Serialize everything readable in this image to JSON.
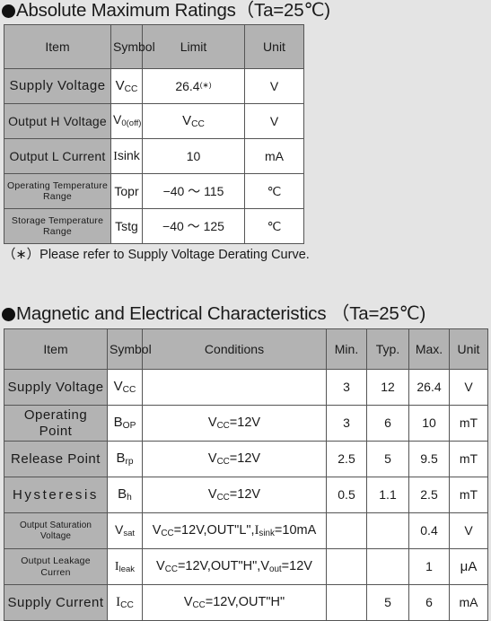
{
  "sections": [
    {
      "id": "absolute-maximum-ratings",
      "title": "Absolute Maximum Ratings（Ta=25℃)",
      "note": "（∗）Please refer to Supply Voltage Derating Curve.",
      "headers": [
        "Item",
        "Symbol",
        "Limit",
        "Unit"
      ],
      "rows": [
        {
          "item": "Supply  Voltage",
          "symbol_base": "V",
          "symbol_sub": "CC",
          "limit": "26.4",
          "limit_sup": "(∗)",
          "unit": "V"
        },
        {
          "item": "Output H Voltage",
          "symbol_base": "V",
          "symbol_sub": "0(off)",
          "limit_base": "V",
          "limit_sub": "CC",
          "unit": "V"
        },
        {
          "item": "Output L Current",
          "symbol_base": "I",
          "symbol_sub": "sink",
          "symbol_plain": "Isink",
          "limit": "10",
          "unit": "mA"
        },
        {
          "item": "Operating Temperature Range",
          "symbol_plain": "Topr",
          "limit": "−40 ～ 115",
          "unit": "℃"
        },
        {
          "item": "Storage Temperature Range",
          "symbol_plain": "Tstg",
          "limit": "−40 ～ 125",
          "unit": "℃"
        }
      ]
    },
    {
      "id": "magnetic-and-electrical-characteristics",
      "title": "Magnetic and Electrical Characteristics （Ta=25℃)",
      "headers": [
        "Item",
        "Symbol",
        "Conditions",
        "Min.",
        "Typ.",
        "Max.",
        "Unit"
      ],
      "rows": [
        {
          "item": "Supply  Voltage",
          "symbol_base": "V",
          "symbol_sub": "CC",
          "conditions": "",
          "min": "3",
          "typ": "12",
          "max": "26.4",
          "unit": "V"
        },
        {
          "item": "Operating Point",
          "symbol_base": "B",
          "symbol_sub": "OP",
          "cond_base": "V",
          "cond_sub": "CC",
          "cond_tail": "=12V",
          "min": "3",
          "typ": "6",
          "max": "10",
          "unit": "mT"
        },
        {
          "item": "Release  Point",
          "symbol_base": "B",
          "symbol_sub": "rp",
          "cond_base": "V",
          "cond_sub": "CC",
          "cond_tail": "=12V",
          "min": "2.5",
          "typ": "5",
          "max": "9.5",
          "unit": "mT"
        },
        {
          "item": "Hysteresis",
          "symbol_base": "B",
          "symbol_sub": "h",
          "cond_base": "V",
          "cond_sub": "CC",
          "cond_tail": "=12V",
          "min": "0.5",
          "typ": "1.1",
          "max": "2.5",
          "unit": "mT"
        },
        {
          "item": "Output  Saturation  Voltage",
          "symbol_base": "V",
          "symbol_sub": "sat",
          "cond_base": "V",
          "cond_sub": "CC",
          "cond_mid": "=12V,OUT\"L\",",
          "cond_base2": "I",
          "cond_sub2": "sink",
          "cond_tail": "=10mA",
          "min": "",
          "typ": "",
          "max": "0.4",
          "unit": "V"
        },
        {
          "item": "Output Leakage Curren",
          "symbol_base": "I",
          "symbol_sub": "leak",
          "cond_base": "V",
          "cond_sub": "CC",
          "cond_mid": "=12V,OUT\"H\",",
          "cond_base2": "V",
          "cond_sub2": "out",
          "cond_tail": "=12V",
          "min": "",
          "typ": "",
          "max": "1",
          "unit": "μA"
        },
        {
          "item": "Supply  Current",
          "symbol_base": "I",
          "symbol_sub": "CC",
          "cond_base": "V",
          "cond_sub": "CC",
          "cond_tail": "=12V,OUT\"H\"",
          "min": "",
          "typ": "5",
          "max": "6",
          "unit": "mA"
        }
      ]
    }
  ],
  "colors": {
    "page_background": "#e4e4e4",
    "header_fill": "#b3b3b3",
    "cell_fill": "#ffffff",
    "border": "#555555",
    "text": "#1a1a1a"
  }
}
